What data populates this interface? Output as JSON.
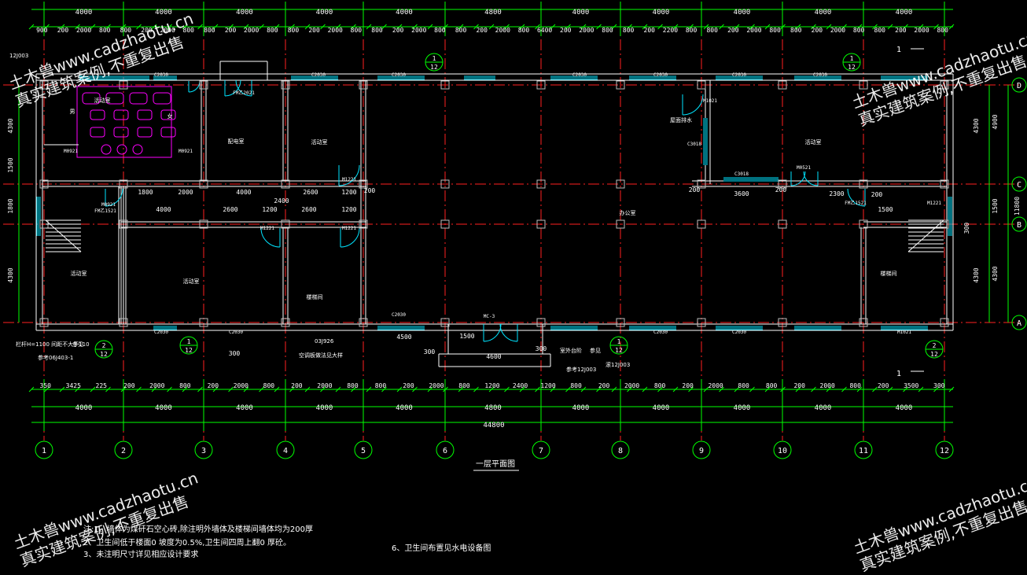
{
  "drawing": {
    "title": "一层平面图",
    "axes_bottom": [
      "1",
      "2",
      "3",
      "4",
      "5",
      "6",
      "7",
      "8",
      "9",
      "10",
      "11",
      "12"
    ],
    "axes_right": [
      "A",
      "B",
      "C",
      "D"
    ],
    "top_bay_dims": [
      "4000",
      "4000",
      "4000",
      "4000",
      "4000",
      "4800",
      "4000",
      "4000",
      "4000",
      "4000",
      "4000"
    ],
    "bottom_bay_dims": [
      "4000",
      "4000",
      "4000",
      "4000",
      "4000",
      "4800",
      "4000",
      "4000",
      "4000",
      "4000",
      "4000"
    ],
    "overall_dim": "44800",
    "top_sub_dims": [
      "900",
      "200",
      "2000",
      "800",
      "800",
      "200",
      "2000",
      "800",
      "800",
      "200",
      "2000",
      "800",
      "800",
      "200",
      "2000",
      "800",
      "800",
      "200",
      "2000",
      "800",
      "800",
      "200",
      "2000",
      "800",
      "6400",
      "200",
      "2000",
      "800",
      "800",
      "200",
      "2200",
      "800",
      "800",
      "200",
      "2000",
      "800",
      "800",
      "200",
      "2000",
      "800",
      "800",
      "200",
      "2000",
      "800"
    ],
    "bottom_sub_dims": [
      "350",
      "3425",
      "225",
      "200",
      "2000",
      "800",
      "200",
      "2000",
      "800",
      "200",
      "2000",
      "800",
      "800",
      "200",
      "2000",
      "800",
      "1200",
      "2400",
      "1200",
      "800",
      "200",
      "2000",
      "800",
      "200",
      "2000",
      "800",
      "800",
      "200",
      "2000",
      "800",
      "200",
      "3500",
      "300"
    ],
    "left_dims": [
      "4300",
      "1500",
      "1800",
      "4300"
    ],
    "right_dims": [
      "4300",
      "4300",
      "1500",
      "4900",
      "4300",
      "11800",
      "300"
    ],
    "room_labels": [
      "男",
      "女",
      "配电室",
      "活动室",
      "活动室",
      "办公室",
      "活动室",
      "活动室",
      "楼梯间",
      "楼梯间",
      "活动室"
    ],
    "window_tags": [
      "C2030",
      "C2030",
      "C2030",
      "C2030",
      "C2030",
      "C2030",
      "C2030",
      "C2030",
      "C2030",
      "C2030",
      "C2030",
      "C2030",
      "C3018",
      "C3018"
    ],
    "door_tags": [
      "FM乙2021",
      "M0921",
      "M0921",
      "M1221",
      "M1221",
      "M1221",
      "M0921",
      "M1221",
      "M0521",
      "FM乙1521",
      "FM乙1521",
      "MC-3",
      "M1021",
      "M1021"
    ],
    "interior_dims": [
      "1800",
      "2000",
      "4000",
      "2600",
      "1200",
      "200",
      "2600",
      "1200",
      "4000",
      "2600",
      "1200",
      "2400",
      "200",
      "3600",
      "2300",
      "200",
      "1500",
      "200",
      "4500",
      "300",
      "4600",
      "300",
      "1500",
      "300"
    ],
    "section_refs": [
      {
        "num": "1",
        "sheet": "12"
      },
      {
        "num": "1",
        "sheet": "12"
      },
      {
        "num": "2",
        "sheet": "12"
      },
      {
        "num": "1",
        "sheet": "12"
      },
      {
        "num": "1",
        "sheet": "12"
      },
      {
        "num": "2",
        "sheet": "12"
      }
    ],
    "callouts": [
      "室外台阶",
      "参见",
      "参考12J003",
      "滚12J003",
      "参考06J403-1",
      "03J926",
      "空调板做法见大样",
      "栏杆H=1100 间距不大于110",
      "参见",
      "屋面排水",
      "12J003"
    ],
    "section_markers": [
      "1",
      "1"
    ],
    "notes": [
      "注:1、墙体为煤矸石空心砖,除注明外墙体及楼梯间墙体均为200厚",
      "2、卫生间低于楼面0  坡度为0.5%,卫生间四周上翻0  厚砼。",
      "3、未注明尺寸详见相应设计要求"
    ],
    "note_extra": "6、卫生间布置见水电设备图",
    "watermark_lines": [
      "土木兽www.cadzhaotu.cn",
      "真实建筑案例,不重复出售"
    ]
  },
  "colors": {
    "background": "#000000",
    "wall": "#ffffff",
    "axis": "#ff2020",
    "dim": "#00ff00",
    "window": "#00e5ff",
    "text": "#ffffff",
    "fixture": "#ff00ff",
    "column": "#bdbdbd",
    "bubble": "#00ff00",
    "label": "#ffff00"
  }
}
